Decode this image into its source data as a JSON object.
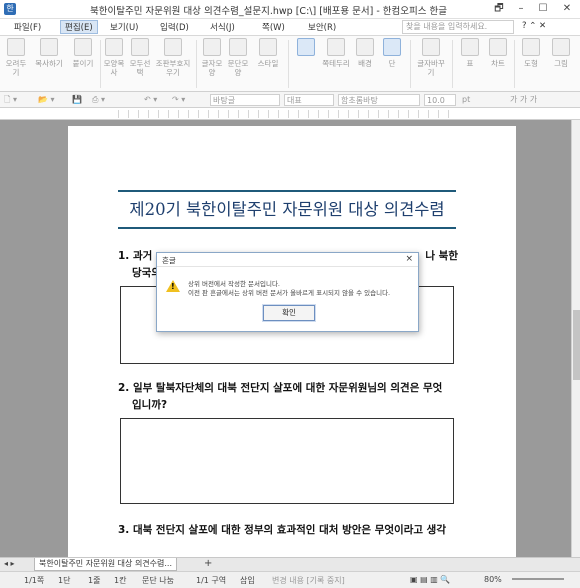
{
  "window": {
    "title": "북한이탈주민 자문위원 대상 의견수렴_설문지.hwp [C:\\] [배포용 문서] - 한컴오피스 한글"
  },
  "menu": {
    "items": [
      "파일(F)",
      "편집(E)",
      "보기(U)",
      "입력(D)",
      "서식(J)",
      "쪽(W)",
      "보안(R)"
    ],
    "active_index": 1,
    "search_placeholder": "찾을 내용을 입력하세요."
  },
  "ribbon": {
    "buttons": [
      "오려두기",
      "복사하기",
      "붙이기",
      "모양복사",
      "모두선택",
      "조판부호지우기",
      "글자모양",
      "문단모양",
      "스타일",
      "",
      "쪽테두리",
      "배경",
      "단",
      "글자바꾸기",
      "표",
      "차트",
      "도형",
      "그림"
    ]
  },
  "toolbar2": {
    "style": "바탕글",
    "lang": "대표",
    "font": "함초롬바탕",
    "size": "10.0",
    "unit": "pt",
    "format_glyphs": "가 가 가"
  },
  "document": {
    "title": "제20기 북한이탈주민 자문위원 대상 의견수렴",
    "q1_line1": "1. 과거",
    "q1_line1_end": "나 북한",
    "q1_line2": "당국의",
    "q2_line1": "2. 일부 탈북자단체의 대북 전단지 살포에 대한 자문위원님의 의견은 무엇",
    "q2_line2": "입니까?",
    "q3_line1": "3. 대북 전단지 살포에 대한 정부의 효과적인 대처 방안은 무엇이라고 생각"
  },
  "tabbar": {
    "tab_label": "북한이탈주민 자문위원 대상 의견수렴...",
    "add": "+"
  },
  "statusbar": {
    "page": "1/1쪽",
    "section": "1단",
    "line": "1줄",
    "col": "1칸",
    "para": "문단 나눔",
    "area": "1/1 구역",
    "insert": "삽입",
    "track": "변경 내용 [기록 중지]",
    "zoom": "80%"
  },
  "dialog": {
    "title": "흔글",
    "close": "×",
    "msg1": "상위 버전에서 작성한 문서입니다.",
    "msg2": "이전 판 흔글에서는 상위 버전 문서가 올바르게 표시되지 않을 수 있습니다.",
    "ok": "확인"
  }
}
